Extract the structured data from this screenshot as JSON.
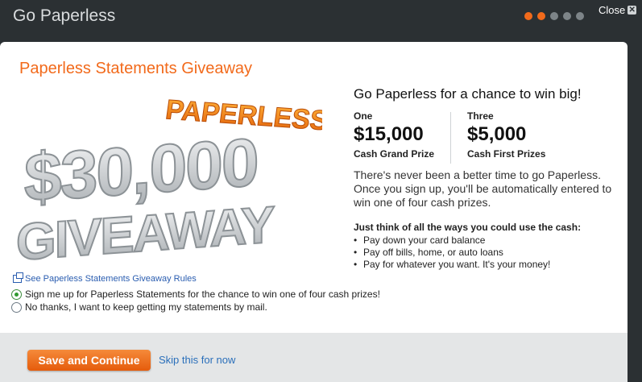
{
  "header": {
    "title": "Go Paperless",
    "close_label": "Close",
    "progress": {
      "total_steps": 5,
      "current_step": 2
    }
  },
  "main": {
    "title": "Paperless Statements Giveaway",
    "art": {
      "amount_text": "$30,000",
      "word_top": "PAPERLESS",
      "word_bottom": "GIVEAWAY"
    },
    "headline": "Go Paperless for a chance to win big!",
    "prizes": [
      {
        "count": "One",
        "amount": "$15,000",
        "desc": "Cash Grand Prize"
      },
      {
        "count": "Three",
        "amount": "$5,000",
        "desc": "Cash First Prizes"
      }
    ],
    "intro": "There's never been a better time to go Paperless. Once you sign up, you'll be automatically entered to win one of four cash prizes.",
    "ways_heading": "Just think of all the ways you could use the cash:",
    "ways": [
      "Pay down your card balance",
      "Pay off bills, home, or auto loans",
      "Pay for whatever you want. It's your money!"
    ],
    "rules_link": "See Paperless Statements Giveaway Rules",
    "options": [
      {
        "label": "Sign me up for Paperless Statements for the chance to win one of four cash prizes!",
        "checked": true
      },
      {
        "label": "No thanks, I want to keep getting my statements by mail.",
        "checked": false
      }
    ]
  },
  "footer": {
    "save_label": "Save and Continue",
    "skip_label": "Skip this for now"
  },
  "colors": {
    "accent": "#f26a1b",
    "link": "#2a6fba",
    "background": "#2b3033"
  }
}
